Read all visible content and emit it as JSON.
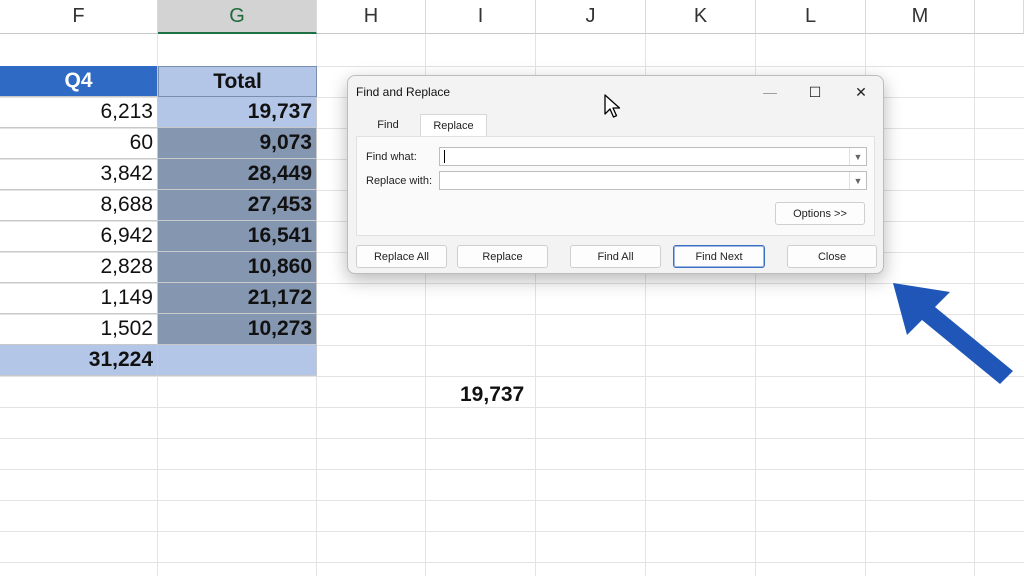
{
  "columns": [
    {
      "id": "col-f",
      "label": "F"
    },
    {
      "id": "col-g",
      "label": "G",
      "selected": true
    },
    {
      "id": "col-h",
      "label": "H"
    },
    {
      "id": "col-i",
      "label": "I"
    },
    {
      "id": "col-j",
      "label": "J"
    },
    {
      "id": "col-k",
      "label": "K"
    },
    {
      "id": "col-l",
      "label": "L"
    },
    {
      "id": "col-m",
      "label": "M"
    }
  ],
  "table": {
    "q4_header": "Q4",
    "total_header": "Total",
    "rows": [
      {
        "q4": "6,213",
        "total": "19,737"
      },
      {
        "q4": "60",
        "total": "9,073"
      },
      {
        "q4": "3,842",
        "total": "28,449"
      },
      {
        "q4": "8,688",
        "total": "27,453"
      },
      {
        "q4": "6,942",
        "total": "16,541"
      },
      {
        "q4": "2,828",
        "total": "10,860"
      },
      {
        "q4": "1,149",
        "total": "21,172"
      },
      {
        "q4": "1,502",
        "total": "10,273"
      }
    ],
    "q4_total": "31,224",
    "total_total": ""
  },
  "floating_value": "19,737",
  "dialog": {
    "title": "Find and Replace",
    "tabs": {
      "find": "Find",
      "replace": "Replace"
    },
    "find_label": "Find what:",
    "replace_label": "Replace with:",
    "find_value": "",
    "replace_value": "",
    "options_button": "Options >>",
    "buttons": {
      "replace_all": "Replace All",
      "replace": "Replace",
      "find_all": "Find All",
      "find_next": "Find Next",
      "close": "Close"
    },
    "controls": {
      "minimize": "—",
      "maximize": "☐",
      "close": "✕"
    }
  },
  "colors": {
    "header_blue": "#2f6bc4",
    "selection_light": "#b4c6e7",
    "selection_dark": "#8496b0",
    "annotation_arrow": "#1f56b8"
  }
}
